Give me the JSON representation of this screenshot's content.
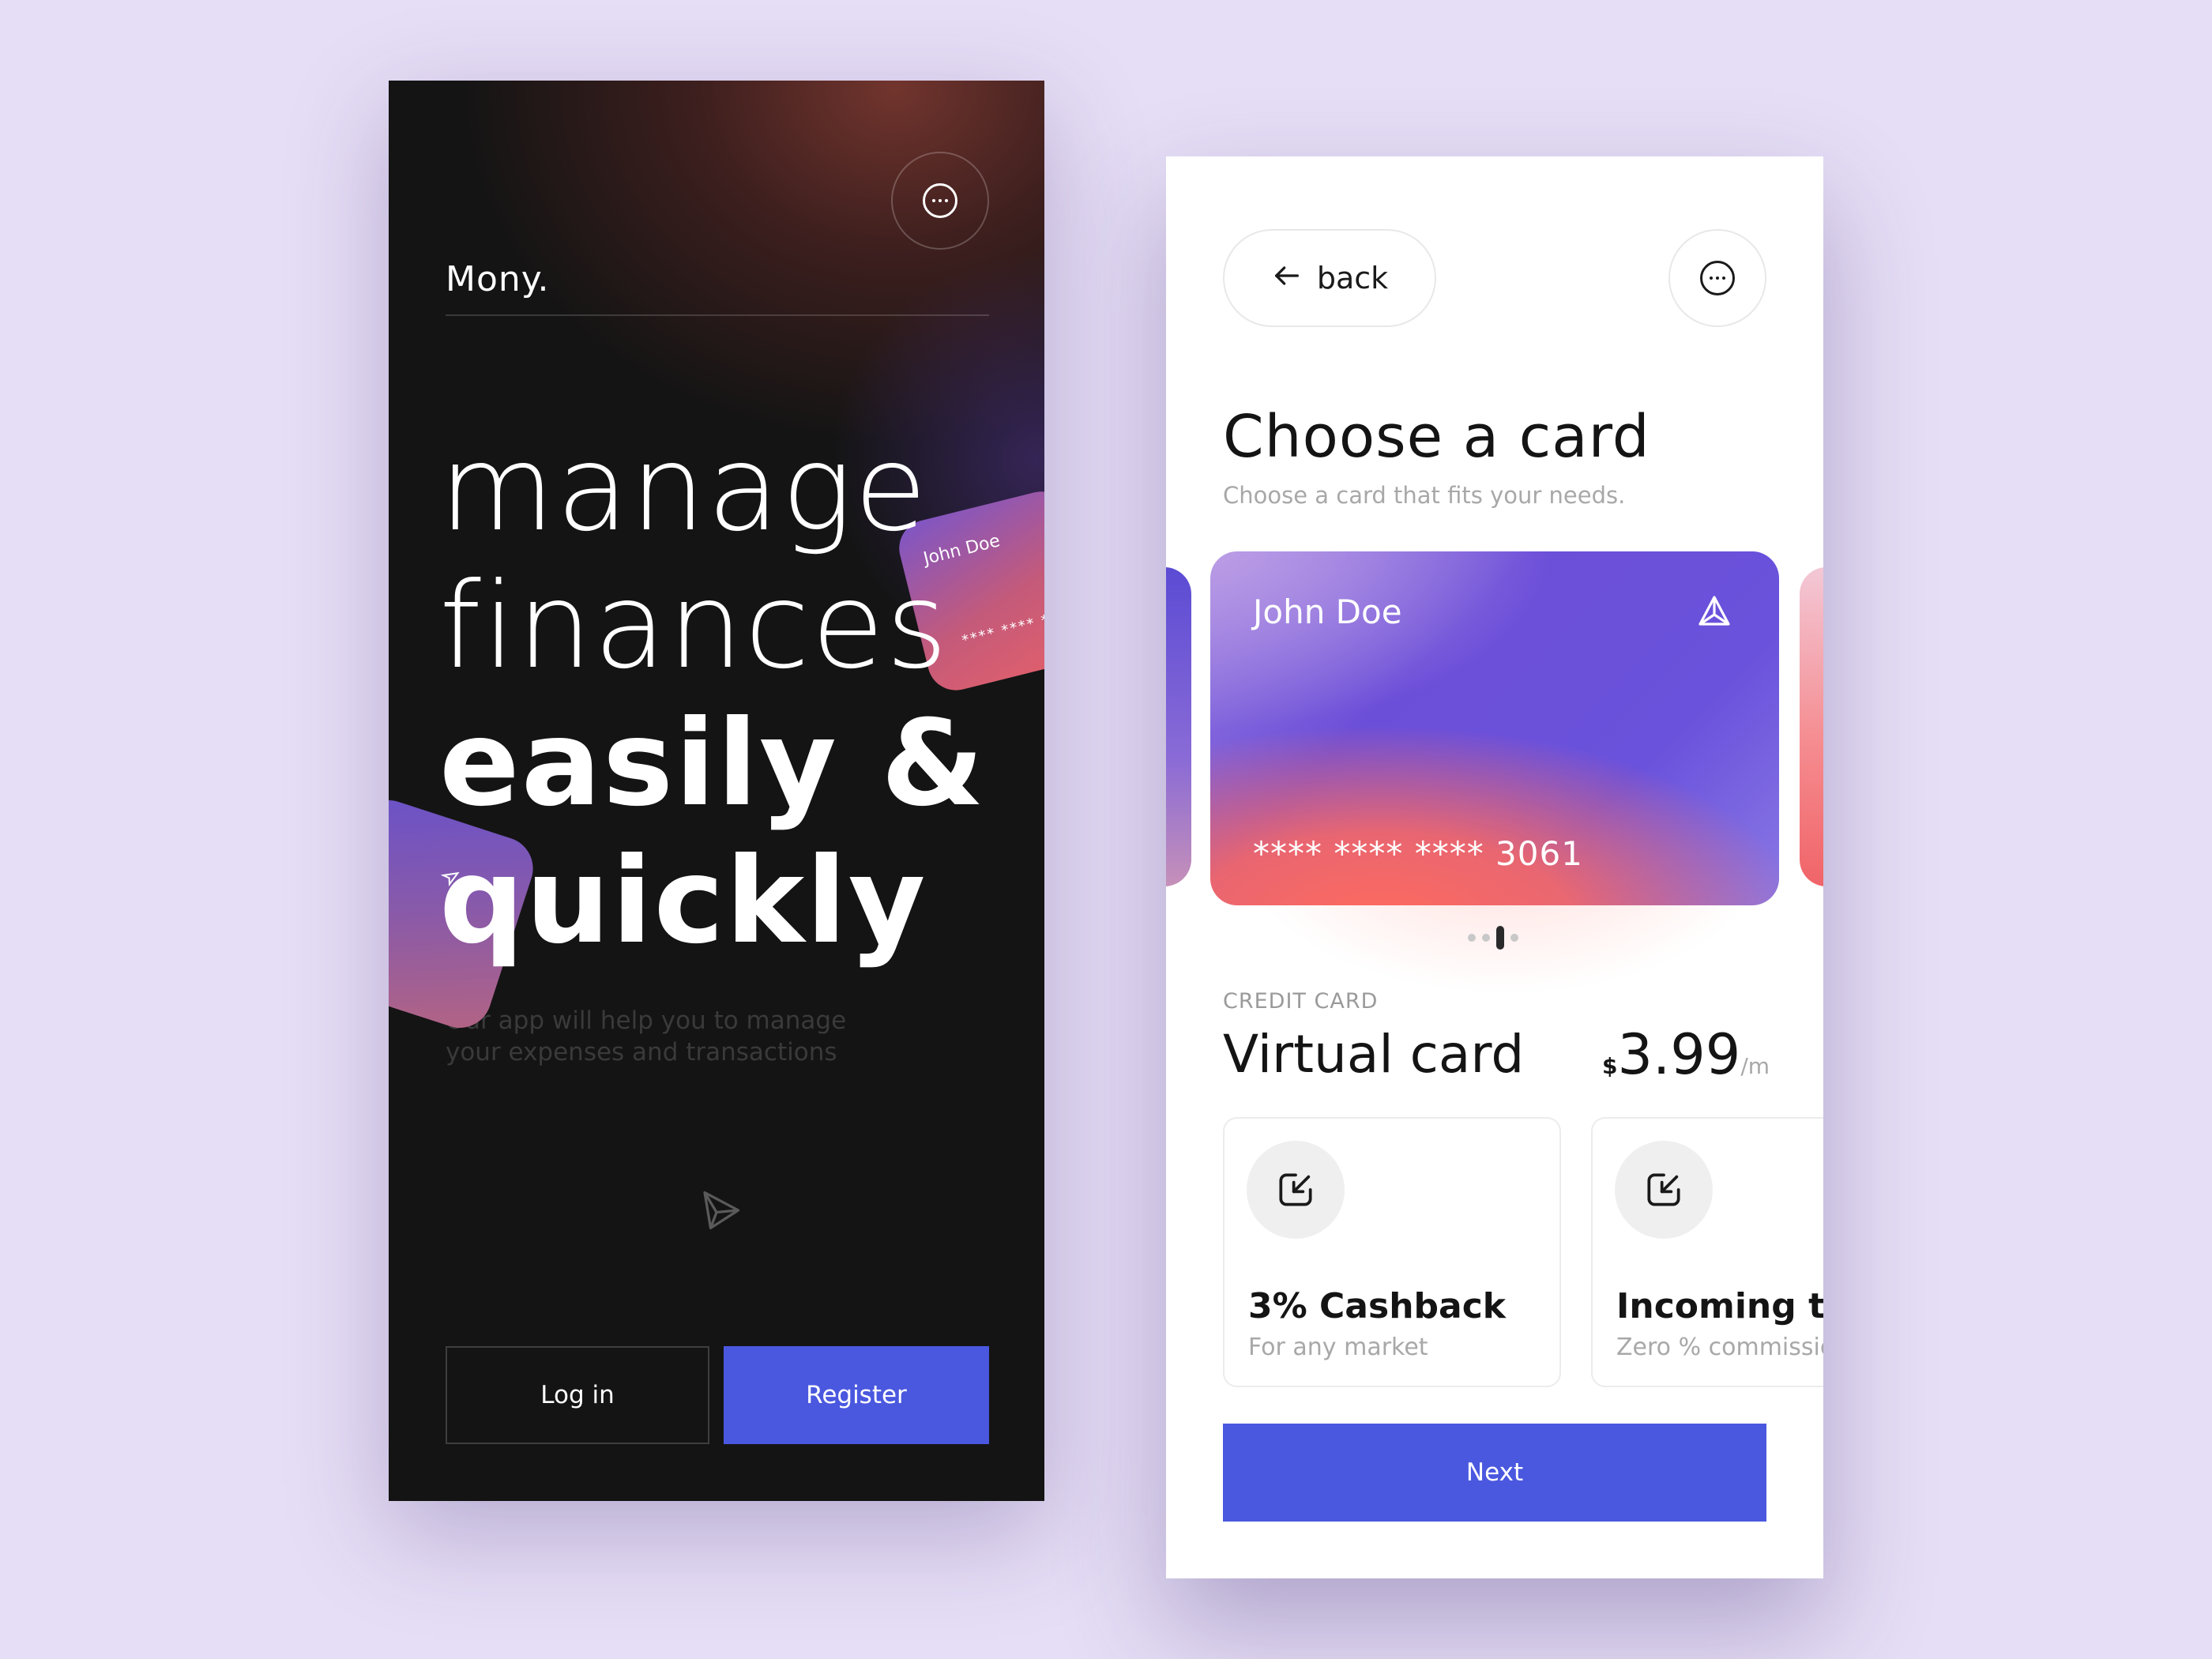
{
  "welcome_screen": {
    "brand": "Mony.",
    "headline_line1": "manage",
    "headline_line2": "finances",
    "headline_line3": "easily &",
    "headline_line4": "quickly",
    "subtitle": "Our app will help you to manage your expenses and transactions",
    "floating_card_name": "John Doe",
    "floating_card_number": "**** **** *",
    "login_label": "Log in",
    "register_label": "Register",
    "icons": [
      "more-icon",
      "paper-plane-logo-icon"
    ]
  },
  "card_screen": {
    "back_label": "back",
    "title": "Choose a card",
    "subtitle": "Choose a card that fits your needs.",
    "selected_card": {
      "holder": "John Doe",
      "number": "**** **** **** 3061"
    },
    "pager": {
      "count": 3,
      "active_index": 2
    },
    "card_type": "CREDIT CARD",
    "card_name": "Virtual card",
    "price": {
      "currency": "$",
      "amount": "3.99",
      "period": "/m"
    },
    "features": [
      {
        "title": "3% Cashback",
        "subtitle": "For any market",
        "icon": "arrow-in-box-icon"
      },
      {
        "title": "Incoming tr",
        "subtitle": "Zero % commissio",
        "icon": "arrow-in-box-icon"
      }
    ],
    "next_label": "Next"
  },
  "colors": {
    "background": "#e6def6",
    "dark_screen": "#141414",
    "accent_blue": "#4a58df",
    "card_violet": "#6c4fd8",
    "card_coral": "#ff6a5e"
  }
}
